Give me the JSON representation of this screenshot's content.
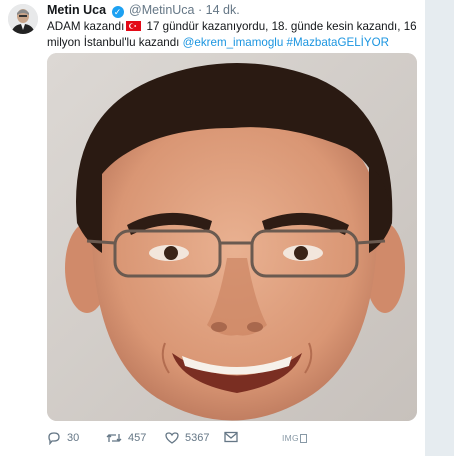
{
  "tweet": {
    "author_name": "Metin Uca",
    "handle": "@MetinUca",
    "separator": "·",
    "time": "14 dk.",
    "text_part1": "ADAM kazandı",
    "text_part2": " 17 gündür kazanıyordu, 18. günde kesin kazandı, 16 milyon İstanbul'lu kazandı ",
    "mention": "@ekrem_imamoglu",
    "hashtag": "#MazbataGELİYOR",
    "reply_count": "30",
    "retweet_count": "457",
    "like_count": "5367",
    "image_label": "IMG"
  },
  "icons": {
    "verified": "verified-badge-icon",
    "flag": "turkey-flag-emoji",
    "reply": "reply-icon",
    "retweet": "retweet-icon",
    "like": "heart-icon",
    "dm": "envelope-icon"
  },
  "colors": {
    "link": "#1b95e0",
    "verified": "#1da1f2",
    "muted": "#657786",
    "background_strip": "#e6ecf0"
  }
}
